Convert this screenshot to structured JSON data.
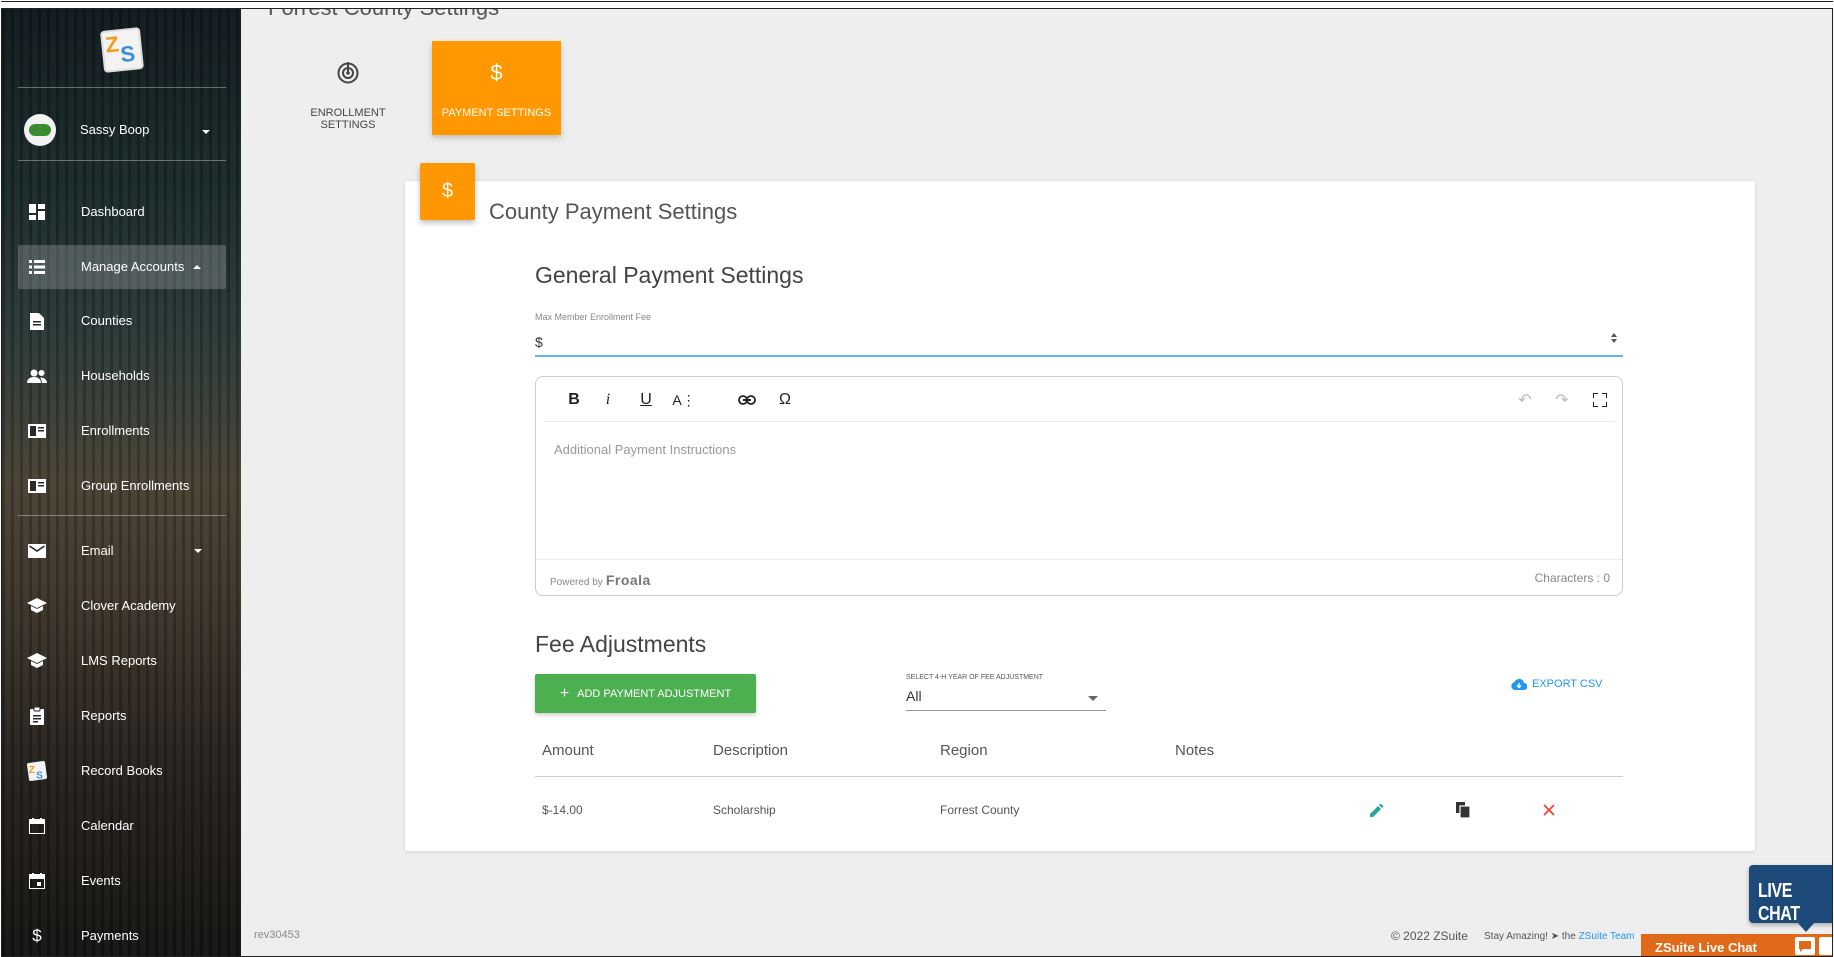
{
  "page": {
    "title": "Forrest County Settings"
  },
  "sidebar": {
    "profile_name": "Sassy Boop",
    "items": [
      {
        "label": "Dashboard",
        "icon": "dashboard-icon"
      },
      {
        "label": "Manage Accounts",
        "icon": "list-icon",
        "active": true
      },
      {
        "label": "Counties",
        "icon": "document-icon"
      },
      {
        "label": "Households",
        "icon": "people-icon"
      },
      {
        "label": "Enrollments",
        "icon": "book-icon"
      },
      {
        "label": "Group Enrollments",
        "icon": "book-icon"
      },
      {
        "label": "Email",
        "icon": "email-icon"
      },
      {
        "label": "Clover Academy",
        "icon": "school-icon"
      },
      {
        "label": "LMS Reports",
        "icon": "school-icon"
      },
      {
        "label": "Reports",
        "icon": "clipboard-icon"
      },
      {
        "label": "Record Books",
        "icon": "zsuite-logo-icon"
      },
      {
        "label": "Calendar",
        "icon": "calendar-icon"
      },
      {
        "label": "Events",
        "icon": "event-icon"
      },
      {
        "label": "Payments",
        "icon": "dollar-icon"
      }
    ]
  },
  "tabs": [
    {
      "label": "ENROLLMENT SETTINGS",
      "icon": "radar-icon"
    },
    {
      "label": "PAYMENT SETTINGS",
      "icon": "dollar-icon",
      "active": true
    }
  ],
  "card": {
    "badge_symbol": "$",
    "title": "County Payment Settings",
    "general_title": "General Payment Settings",
    "fee_label": "Max Member Enrollment Fee",
    "fee_prefix": "$",
    "editor": {
      "placeholder": "Additional Payment Instructions",
      "powered_by": "Powered by",
      "brand": "Froala",
      "char_count": "Characters : 0"
    },
    "fee_adjustments_title": "Fee Adjustments",
    "add_button": "ADD PAYMENT ADJUSTMENT",
    "year_label": "SELECT 4-H YEAR OF FEE ADJUSTMENT",
    "year_value": "All",
    "export_label": "EXPORT CSV",
    "table": {
      "headers": [
        "Amount",
        "Description",
        "Region",
        "Notes"
      ],
      "rows": [
        {
          "amount": "$-14.00",
          "description": "Scholarship",
          "region": "Forrest County",
          "notes": ""
        }
      ]
    }
  },
  "footer": {
    "rev": "rev30453",
    "copyright": "© 2022 ZSuite",
    "stay": "Stay Amazing!",
    "the": "the",
    "team": "ZSuite Team"
  },
  "live_chat": {
    "badge": "LIVE CHAT",
    "bar": "ZSuite Live Chat"
  },
  "colors": {
    "accent_orange": "#ff9800",
    "button_green": "#4caf50",
    "link_blue": "#2196f3",
    "edit_teal": "#26a69a",
    "delete_red": "#f44336",
    "chat_navy": "#1e4a7a",
    "chat_orange": "#e06a1a"
  }
}
